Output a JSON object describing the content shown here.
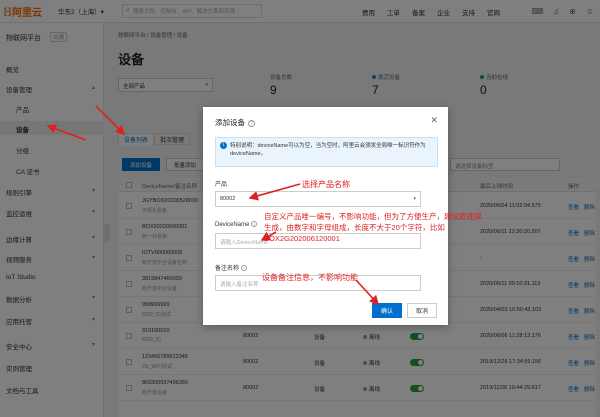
{
  "topbar": {
    "logo": "阿里云",
    "region": "华东2（上海）▾",
    "search_placeholder": "搜索文档、控制台、API、解决方案和资源",
    "nav": [
      "费用",
      "工单",
      "备案",
      "企业",
      "支持",
      "官网"
    ]
  },
  "sidebar": {
    "title": "物联网平台",
    "badge": "公测",
    "items": [
      {
        "label": "概览"
      },
      {
        "label": "设备管理"
      },
      {
        "label": "产品"
      },
      {
        "label": "设备"
      },
      {
        "label": "分组"
      },
      {
        "label": "CA 证书"
      },
      {
        "label": "规则引擎"
      },
      {
        "label": "监控运维"
      },
      {
        "label": "边缘计算"
      },
      {
        "label": "视频服务"
      },
      {
        "label": "IoT Studio"
      },
      {
        "label": "数据分析"
      },
      {
        "label": "应用托管"
      },
      {
        "label": "安全中心"
      },
      {
        "label": "实例管理"
      },
      {
        "label": "文档与工具"
      }
    ]
  },
  "main": {
    "breadcrumb": "物联网平台 / 设备管理 / 设备",
    "title": "设备",
    "product_select": "全部产品",
    "stats": [
      {
        "label": "设备总数",
        "value": "9",
        "color": ""
      },
      {
        "label": "激活设备",
        "value": "7",
        "color": "#2a80d6"
      },
      {
        "label": "当前在线",
        "value": "0",
        "color": "#2a9d3e"
      }
    ],
    "tabs": [
      "设备列表",
      "批次管理"
    ],
    "add_button": "添加设备",
    "batch_button": "批量添加",
    "right_search": "请选择设备标签",
    "columns": [
      "DeviceName/备注名称",
      "最后上线时间",
      "操作"
    ],
    "rows": [
      {
        "name": "JGYBOX20200528000",
        "sub": "可视化看板",
        "time": "2020/06/04 11:02:04.575",
        "product": "",
        "type": "",
        "status": ""
      },
      {
        "name": "BOX20200500001",
        "sub": "新一代看板",
        "time": "2020/06/11 22:30:20.507",
        "product": "",
        "type": "",
        "status": ""
      },
      {
        "name": "IOTV000000005",
        "sub": "新开放平台设备名称",
        "time": "-",
        "product": "",
        "type": "",
        "status": ""
      },
      {
        "name": "3819847460000",
        "sub": "新开放平台设备",
        "time": "2020/06/11 09:10:31.113",
        "product": "",
        "type": "",
        "status": ""
      },
      {
        "name": "999999999",
        "sub": "8002_ID测试",
        "time": "2020/04/03 10:50:43.103",
        "product": "",
        "type": "",
        "status": ""
      },
      {
        "name": "910100010",
        "sub": "8002_ID",
        "time": "2020/06/06 11:28:13.176",
        "product": "80002",
        "type": "设备",
        "status": "离线"
      },
      {
        "name": "123456789012345",
        "sub": "2G_WIFI测试",
        "time": "2019/12/26 17:34:59.156",
        "product": "80002",
        "type": "设备",
        "status": "离线"
      },
      {
        "name": "869300037406356",
        "sub": "新开放设备",
        "time": "2019/11/28 10:44:29.617",
        "product": "80002",
        "type": "设备",
        "status": "离线"
      }
    ],
    "row_actions": [
      "查看",
      "删除"
    ]
  },
  "modal": {
    "title": "添加设备",
    "notice": "特别说明：deviceName可以为空，当为空时，阿里云会颁发全局唯一标识符作为deviceName。",
    "product_label": "产品",
    "product_value": "80002",
    "devicename_label": "DeviceName",
    "devicename_placeholder": "请输入DeviceName",
    "remark_label": "备注名称",
    "remark_placeholder": "请输入备注名称",
    "ok": "确认",
    "cancel": "取消"
  },
  "annotations": {
    "product": "选择产品名称",
    "devicename": "自定义产品唯一编号，不影响功能，但为了方便生产，建议按规律生成，由数字和字母组成，长度不大于20个字符，比如BOX2G202006120001",
    "remark": "设备备注信息，不影响功能"
  }
}
